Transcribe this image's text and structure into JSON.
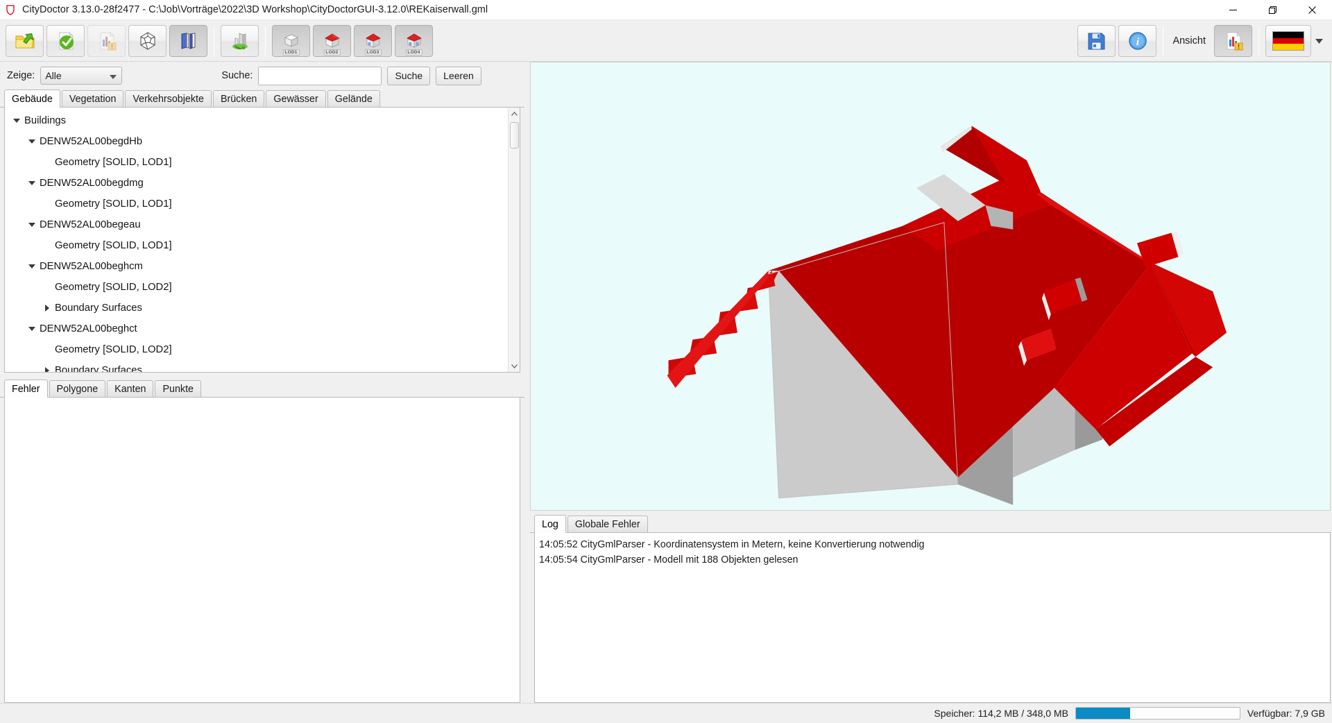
{
  "window": {
    "icon": "shield-icon",
    "title": "CityDoctor 3.13.0-28f2477 - C:\\Job\\Vorträge\\2022\\3D Workshop\\CityDoctorGUI-3.12.0\\REKaiserwall.gml",
    "controls": {
      "minimize": "—",
      "maximize": "❐",
      "close": "✕"
    }
  },
  "toolbar": {
    "buttons": [
      {
        "name": "open-file-button",
        "icon": "open-folder-icon",
        "state": "enabled"
      },
      {
        "name": "validate-button",
        "icon": "green-check-document-icon",
        "state": "enabled"
      },
      {
        "name": "report-button",
        "icon": "report-document-icon",
        "state": "disabled"
      },
      {
        "name": "polyhedron-button",
        "icon": "polyhedron-icon",
        "state": "enabled"
      },
      {
        "name": "planes-button",
        "icon": "blue-planes-icon",
        "state": "pressed"
      },
      {
        "name": "city-button",
        "icon": "city-refresh-icon",
        "state": "enabled"
      },
      {
        "name": "lod1-button",
        "icon": "cube-icon",
        "label": "LOD1",
        "state": "pressed"
      },
      {
        "name": "lod2-button",
        "icon": "house-red-roof-icon",
        "label": "LOD2",
        "state": "pressed"
      },
      {
        "name": "lod3-button",
        "icon": "house-red-roof-icon",
        "label": "LOD3",
        "state": "pressed"
      },
      {
        "name": "lod4-button",
        "icon": "house-red-roof-icon",
        "label": "LOD4",
        "state": "pressed"
      }
    ],
    "save_icon": "floppy-save-icon",
    "info_icon": "info-circle-icon",
    "ansicht_label": "Ansicht",
    "view_report_icon": "report-document-icon",
    "language_flag": "german-flag-icon",
    "flag_colors": [
      "#000000",
      "#dd0000",
      "#ffce00"
    ]
  },
  "filter": {
    "zeige_label": "Zeige:",
    "zeige_value": "Alle",
    "zeige_options": [
      "Alle"
    ],
    "suche_label": "Suche:",
    "suche_value": "",
    "suche_placeholder": "",
    "suche_button": "Suche",
    "leeren_button": "Leeren"
  },
  "object_tabs": {
    "active": "Gebäude",
    "items": [
      {
        "label": "Gebäude",
        "name": "tab-gebaeude"
      },
      {
        "label": "Vegetation",
        "name": "tab-vegetation"
      },
      {
        "label": "Verkehrsobjekte",
        "name": "tab-verkehrsobjekte"
      },
      {
        "label": "Brücken",
        "name": "tab-bruecken"
      },
      {
        "label": "Gewässer",
        "name": "tab-gewaesser"
      },
      {
        "label": "Gelände",
        "name": "tab-gelaende"
      }
    ]
  },
  "tree": [
    {
      "label": "Buildings",
      "depth": 0,
      "toggle": "down"
    },
    {
      "label": "DENW52AL00begdHb",
      "depth": 1,
      "toggle": "down"
    },
    {
      "label": "Geometry [SOLID, LOD1]",
      "depth": 2,
      "toggle": "none"
    },
    {
      "label": "DENW52AL00begdmg",
      "depth": 1,
      "toggle": "down"
    },
    {
      "label": "Geometry [SOLID, LOD1]",
      "depth": 2,
      "toggle": "none"
    },
    {
      "label": "DENW52AL00begeau",
      "depth": 1,
      "toggle": "down"
    },
    {
      "label": "Geometry [SOLID, LOD1]",
      "depth": 2,
      "toggle": "none"
    },
    {
      "label": "DENW52AL00beghcm",
      "depth": 1,
      "toggle": "down"
    },
    {
      "label": "Geometry [SOLID, LOD2]",
      "depth": 2,
      "toggle": "none"
    },
    {
      "label": "Boundary Surfaces",
      "depth": 2,
      "toggle": "right"
    },
    {
      "label": "DENW52AL00beghct",
      "depth": 1,
      "toggle": "down"
    },
    {
      "label": "Geometry [SOLID, LOD2]",
      "depth": 2,
      "toggle": "none"
    },
    {
      "label": "Boundary Surfaces",
      "depth": 2,
      "toggle": "right"
    }
  ],
  "error_tabs": {
    "active": "Fehler",
    "items": [
      {
        "label": "Fehler",
        "name": "tab-fehler"
      },
      {
        "label": "Polygone",
        "name": "tab-polygone"
      },
      {
        "label": "Kanten",
        "name": "tab-kanten"
      },
      {
        "label": "Punkte",
        "name": "tab-punkte"
      }
    ]
  },
  "viewport": {
    "background": "#e9fcfb",
    "roof_color": "#cc0000",
    "roof_dark_color": "#b00000",
    "wall_color": "#cccccc",
    "wall_shade_color": "#a8a8a8"
  },
  "log_tabs": {
    "active": "Log",
    "items": [
      {
        "label": "Log",
        "name": "tab-log"
      },
      {
        "label": "Globale Fehler",
        "name": "tab-globale-fehler"
      }
    ]
  },
  "log_lines": [
    "14:05:52 CityGmlParser - Koordinatensystem in Metern, keine Konvertierung notwendig",
    "14:05:54 CityGmlParser - Modell mit 188 Objekten gelesen"
  ],
  "statusbar": {
    "memory_label": "Speicher: 114,2 MB / 348,0 MB",
    "memory_percent": 33,
    "memory_bar_color": "#0a8bc4",
    "available_label": "Verfügbar: 7,9 GB"
  }
}
